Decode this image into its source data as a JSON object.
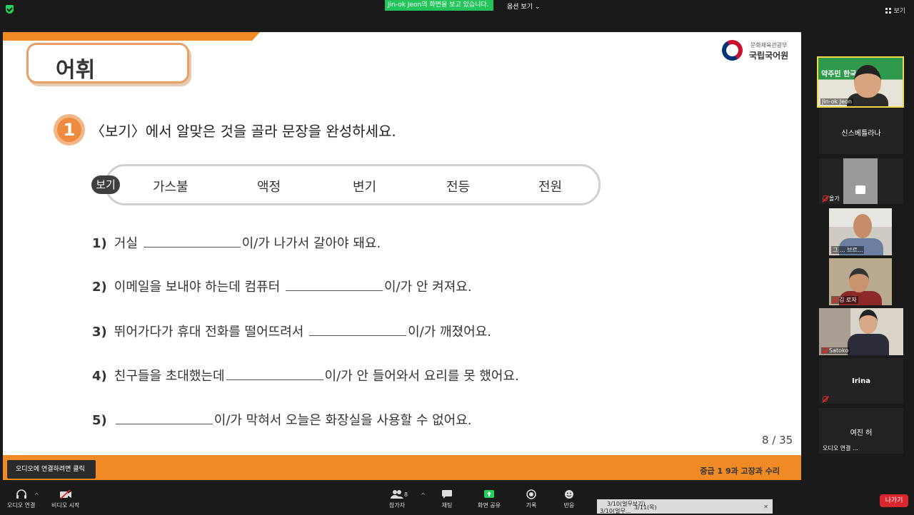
{
  "topbar": {
    "share_banner": "Jin-ok  Jeon의 화면을 보고 있습니다.",
    "view_options": "옵션 보기 ⌄",
    "view_label": "보기"
  },
  "slide": {
    "title": "어휘",
    "logo_small": "문화체육관광부",
    "logo_big": "국립국어원",
    "question_number": "1",
    "instruction": "〈보기〉에서 알맞은 것을 골라 문장을 완성하세요.",
    "bogi_label": "보기",
    "bogi_words": [
      "가스불",
      "액정",
      "변기",
      "전등",
      "전원"
    ],
    "sentences": [
      {
        "num": "1)",
        "before": "거실",
        "after": "이/가 나가서 갈아야 돼요."
      },
      {
        "num": "2)",
        "before": "이메일을 보내야 하는데 컴퓨터",
        "after": "이/가 안 켜져요."
      },
      {
        "num": "3)",
        "before": "뛰어가다가 휴대 전화를 떨어뜨려서",
        "after": "이/가 깨졌어요."
      },
      {
        "num": "4)",
        "before": "친구들을 초대했는데",
        "after": "이/가 안 들어와서 요리를 못 했어요."
      },
      {
        "num": "5)",
        "before": "",
        "after": "이/가 막혀서 오늘은 화장실을 사용할 수 없어요."
      }
    ],
    "page_number": "8  / 35",
    "footer": "중급 1  9과 고장과 수리"
  },
  "tooltip": "오디오에 연결하려면 클릭",
  "participants": {
    "active": {
      "name": "Jin-ok Jeon",
      "banner": "약주민 한국어  신청"
    },
    "name_tile": "신스베틀라나",
    "p1": "올가",
    "p2": "그 ... 브르...",
    "p3": "김 로자",
    "p4": "Satoko",
    "p5": "Irina",
    "p6": "여진 허",
    "p6_status": "오디오 연결 ..."
  },
  "toolbar": {
    "audio": "오디오 연결",
    "video": "비디오 시작",
    "participants": "참가자",
    "participants_count": "8",
    "chat": "채팅",
    "share": "화면 공유",
    "record": "기록",
    "reactions": "반응",
    "leave": "나가기"
  },
  "taskbar": {
    "tab1": "3/10(얼무보기)",
    "tab2": "3/11(목)",
    "tab3": "3/10(얼무..."
  },
  "colors": {
    "accent_orange": "#f08a24",
    "share_green": "#23c45a",
    "leave_red": "#d9262f",
    "active_border": "#f1d94a"
  }
}
